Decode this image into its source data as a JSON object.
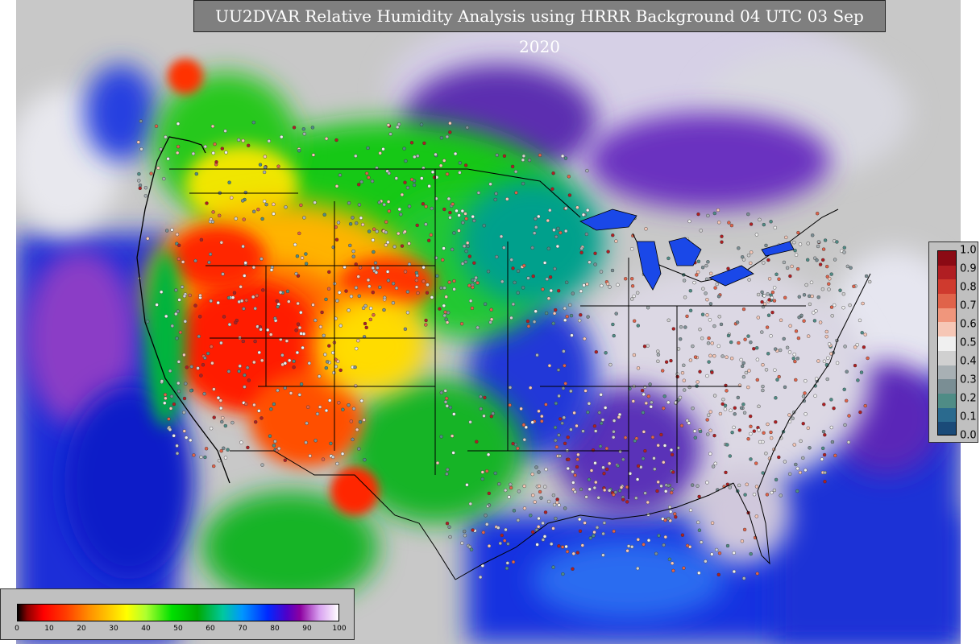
{
  "title": "UU2DVAR Relative Humidity Analysis using HRRR Background 04 UTC 03 Sep 2020",
  "rh_colorbar": {
    "ticks": [
      "0",
      "10",
      "20",
      "30",
      "40",
      "50",
      "60",
      "70",
      "80",
      "90",
      "100"
    ]
  },
  "obs_colorbar": {
    "ticks": [
      "1.0",
      "0.9",
      "0.8",
      "0.7",
      "0.6",
      "0.5",
      "0.4",
      "0.3",
      "0.2",
      "0.1",
      "0.0"
    ],
    "colors": [
      "#8b0a14",
      "#b01e22",
      "#cf3a2e",
      "#e0634a",
      "#f0967c",
      "#f6c7b6",
      "#f0f0f0",
      "#d0d0d0",
      "#a8b0b4",
      "#7a8e94",
      "#4f8c86",
      "#2a6a8e",
      "#1a4a78"
    ]
  },
  "colors": {
    "background_land": "#c8c8c8",
    "title_box": "#7f7f7f",
    "dry": "#ff0000",
    "moist": "#00c800",
    "humid": "#0028ff"
  }
}
